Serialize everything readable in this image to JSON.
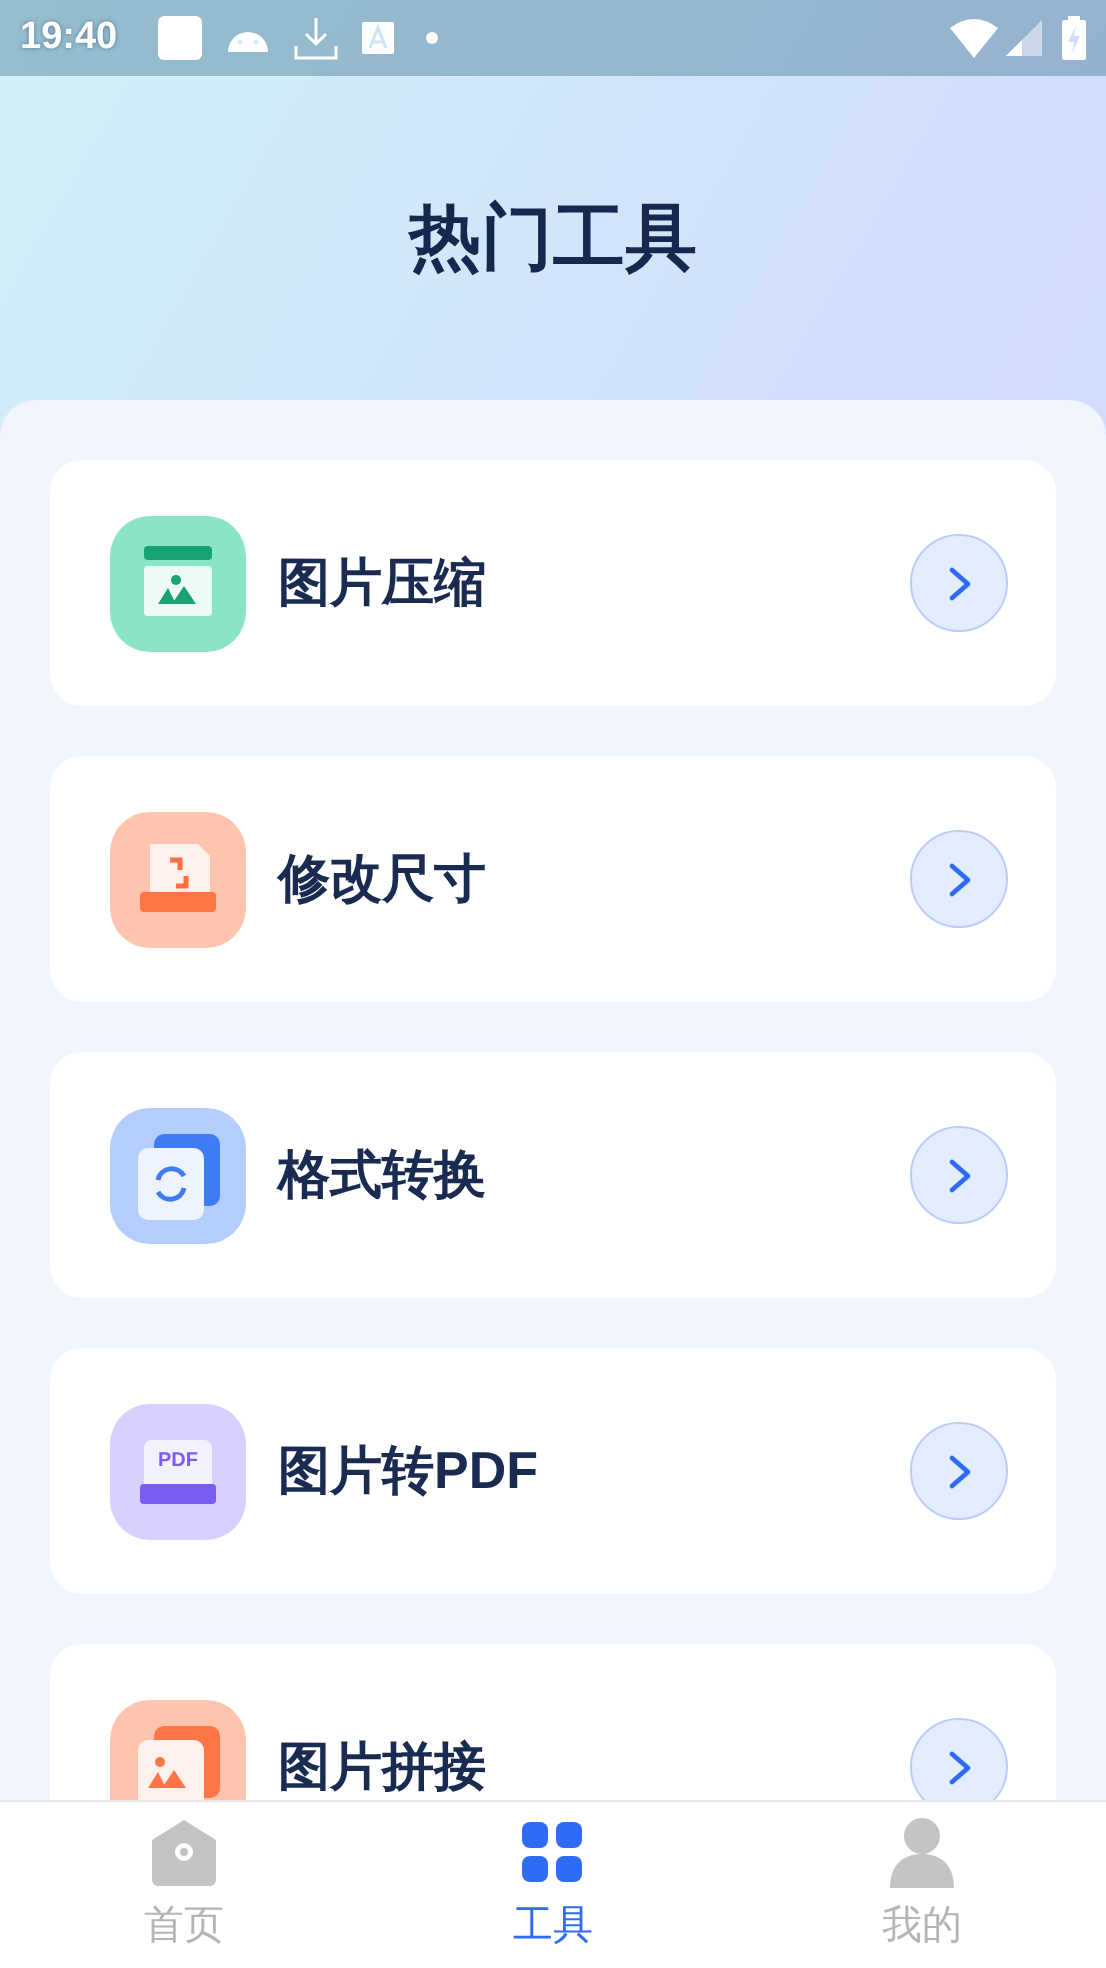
{
  "status_bar": {
    "time": "19:40"
  },
  "header": {
    "title": "热门工具"
  },
  "tools": [
    {
      "kind": "compress",
      "label": "图片压缩"
    },
    {
      "kind": "resize",
      "label": "修改尺寸"
    },
    {
      "kind": "convert",
      "label": "格式转换"
    },
    {
      "kind": "pdf",
      "label": "图片转PDF",
      "icon_text": "PDF"
    },
    {
      "kind": "stitch",
      "label": "图片拼接"
    }
  ],
  "tabs": [
    {
      "kind": "home",
      "label": "首页",
      "selected": false
    },
    {
      "kind": "tools",
      "label": "工具",
      "selected": true
    },
    {
      "kind": "me",
      "label": "我的",
      "selected": false
    }
  ]
}
